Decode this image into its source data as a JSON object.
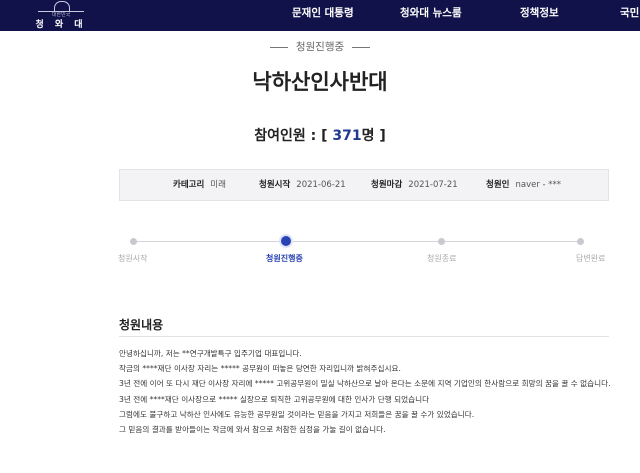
{
  "header": {
    "logo": {
      "sub": "대한민국",
      "main": "청 와 대"
    },
    "nav": [
      "문재인 대통령",
      "청와대 뉴스룸",
      "정책정보",
      "국민"
    ]
  },
  "petition": {
    "status": "청원진행중",
    "title": "낙하산인사반대",
    "count_prefix": "참여인원 : [ ",
    "count_value": "371",
    "count_suffix": "명 ]",
    "info": [
      {
        "key": "카테고리",
        "value": "미래"
      },
      {
        "key": "청원시작",
        "value": "2021-06-21"
      },
      {
        "key": "청원마감",
        "value": "2021-07-21"
      },
      {
        "key": "청원인",
        "value": "naver - ***"
      }
    ],
    "progress": {
      "steps": [
        "청원시작",
        "청원진행중",
        "청원종료",
        "답변완료"
      ],
      "active_index": 1
    },
    "content": {
      "heading": "청원내용",
      "paragraphs": [
        "안녕하십니까, 저는 **연구개발특구 입주기업 대표입니다.",
        "작금의 ****재단 이사장 자리는 ***** 공무원이 떠놓은 당연한 자리입니까 밝혀주십시요.",
        "3년 전에 이어 또 다시 재단 이사장 자리에 ***** 고위공무원이 밀실 낙하산으로 날아 온다는 소문에 지역 기업인의 한사람으로 희망의 꿈을 꿀 수 없습니다.",
        "3년 전에 ****재단 이사장으로 ***** 실장으로 퇴직한 고위공무원에 대한 인사가 단행 되었습니다",
        "그럼에도 불구하고 낙하산 인사에도 유능한 공무원일 것이라는 믿음을 가지고 저희들은 꿈을 꿀 수가 있었습니다.",
        "그 믿음의 결과를 받아들이는 작금에 와서 참으로 처참한 심정을 가눌 길이 없습니다."
      ]
    }
  }
}
